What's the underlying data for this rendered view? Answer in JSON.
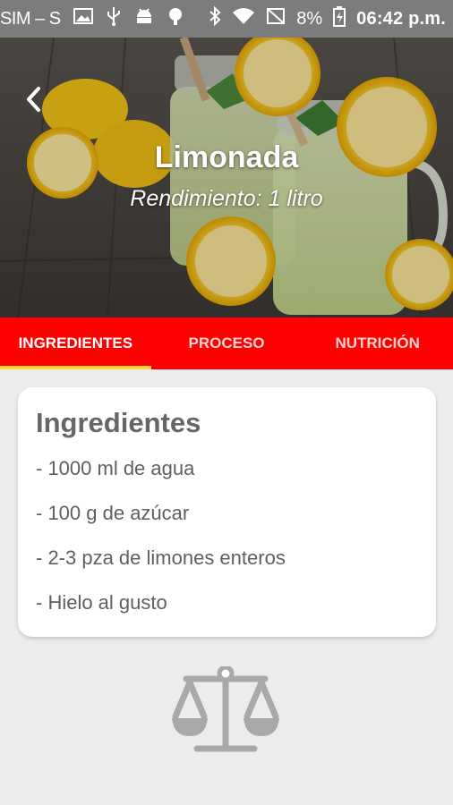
{
  "status_bar": {
    "carrier": "SIM – S",
    "battery": "8%",
    "time": "06:42 p.m."
  },
  "recipe": {
    "title": "Limonada",
    "yield": "Rendimiento: 1 litro"
  },
  "tabs": [
    {
      "label": "INGREDIENTES",
      "active": true
    },
    {
      "label": "PROCESO",
      "active": false
    },
    {
      "label": "NUTRICIÓN",
      "active": false
    }
  ],
  "ingredients": {
    "heading": "Ingredientes",
    "items": [
      "- 1000 ml de agua",
      "- 100 g de azúcar",
      "- 2-3 pza de limones enteros",
      "- Hielo al gusto"
    ]
  },
  "icons": {
    "back": "chevron-left-icon",
    "footer": "scale-balance-icon"
  },
  "colors": {
    "accent": "#ff0000",
    "tab_indicator": "#ffd633",
    "status_bar": "#7c7c7c",
    "background": "#ececef"
  }
}
